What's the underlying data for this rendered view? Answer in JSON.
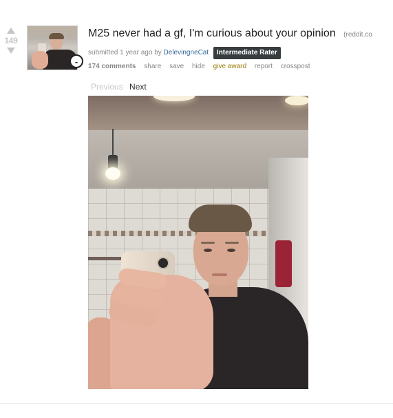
{
  "post": {
    "score": "149",
    "title": "M25 never had a gf, I'm curious about your opinion",
    "domain": "(reddit.co",
    "submitted_prefix": "submitted",
    "time": "1 year ago",
    "by": "by",
    "author": "DelevingneCat",
    "flair": "Intermediate Rater",
    "expando_label": "-",
    "buttons": {
      "comments": "174 comments",
      "share": "share",
      "save": "save",
      "hide": "hide",
      "give_award": "give award",
      "report": "report",
      "crosspost": "crosspost"
    }
  },
  "gallery": {
    "previous": "Previous",
    "next": "Next"
  },
  "colors": {
    "flair_bg": "#373c3f",
    "award": "#9a7d0a",
    "author": "#336699",
    "muted": "#888888"
  }
}
